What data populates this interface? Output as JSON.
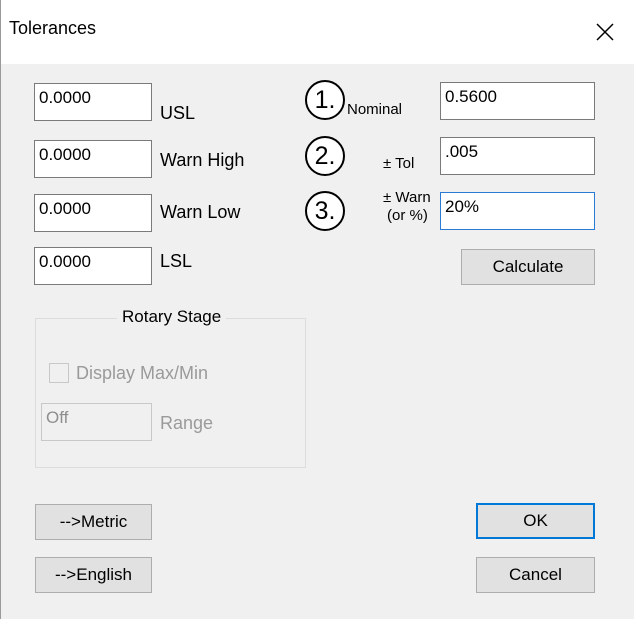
{
  "window": {
    "title": "Tolerances",
    "close_glyph": "✕"
  },
  "left_fields": [
    {
      "value": "0.0000",
      "label": "USL"
    },
    {
      "value": "0.0000",
      "label": "Warn High"
    },
    {
      "value": "0.0000",
      "label": "Warn Low"
    },
    {
      "value": "0.0000",
      "label": "LSL"
    }
  ],
  "steps": [
    {
      "number": "1.",
      "label": "Nominal",
      "value": "0.5600"
    },
    {
      "number": "2.",
      "label": "± Tol",
      "value": ".005"
    },
    {
      "number": "3.",
      "label_line1": "± Warn",
      "label_line2": "(or %)",
      "value": "20%"
    }
  ],
  "calculate_label": "Calculate",
  "rotary_stage": {
    "title": "Rotary Stage",
    "display_maxmin_label": "Display Max/Min",
    "display_maxmin_checked": false,
    "range_value": "Off",
    "range_label": "Range"
  },
  "buttons": {
    "metric": "-->Metric",
    "english": "-->English",
    "ok": "OK",
    "cancel": "Cancel"
  },
  "colors": {
    "focus_border": "#2a7bd6",
    "default_button_border": "#0078d7",
    "disabled_text": "#9a9a9a"
  }
}
